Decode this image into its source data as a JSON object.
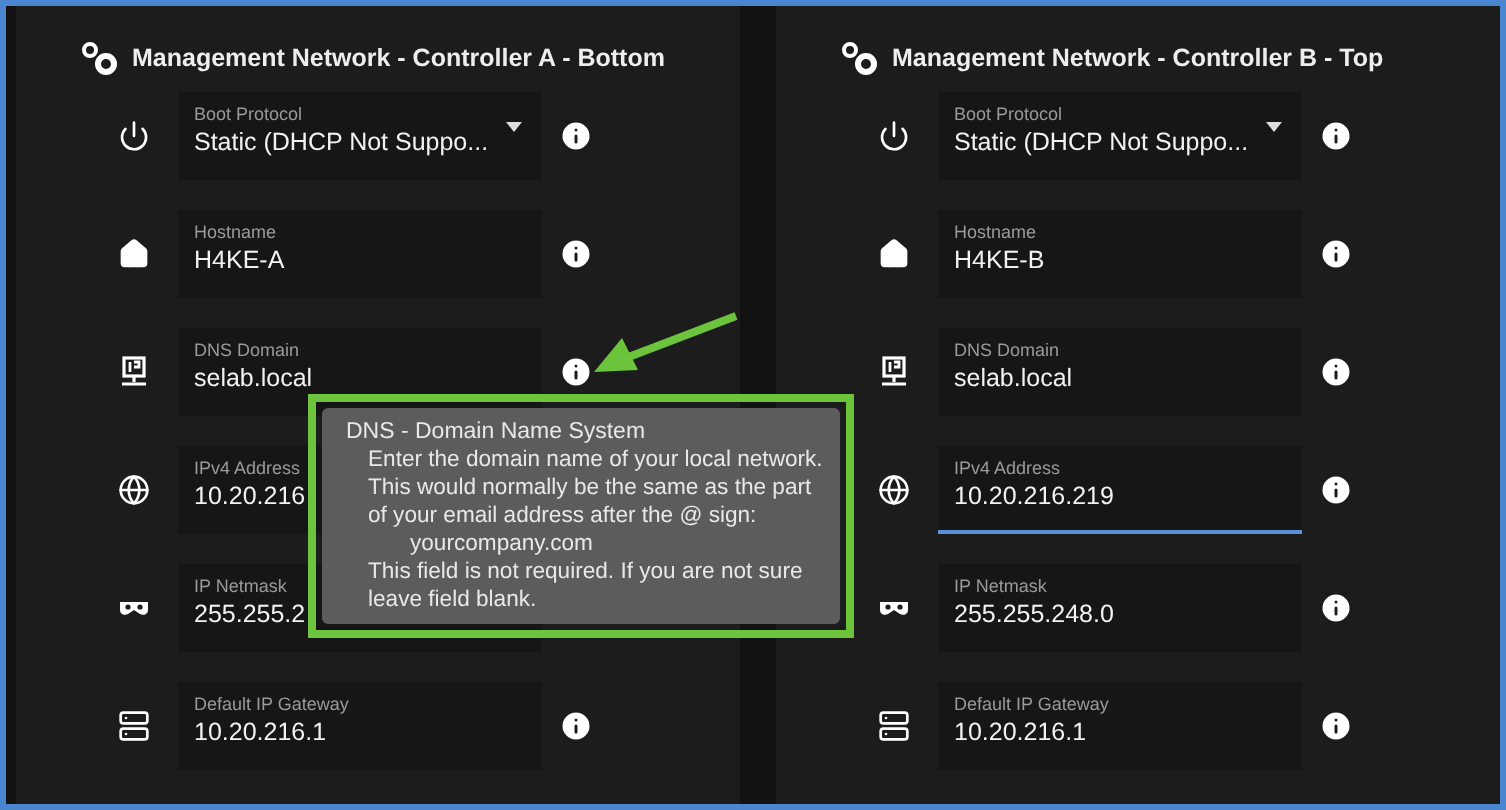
{
  "panels": [
    {
      "title": "Management Network - Controller A - Bottom",
      "fields": [
        {
          "kind": "select",
          "label": "Boot Protocol",
          "value": "Static (DHCP Not Suppo...",
          "focused": false,
          "info": true
        },
        {
          "kind": "text",
          "label": "Hostname",
          "value": "H4KE-A",
          "focused": false,
          "info": true
        },
        {
          "kind": "text",
          "label": "DNS Domain",
          "value": "selab.local",
          "focused": false,
          "info": true
        },
        {
          "kind": "text",
          "label": "IPv4 Address",
          "value": "10.20.216",
          "focused": false,
          "info": false
        },
        {
          "kind": "text",
          "label": "IP Netmask",
          "value": "255.255.2",
          "focused": false,
          "info": false
        },
        {
          "kind": "text",
          "label": "Default IP Gateway",
          "value": "10.20.216.1",
          "focused": false,
          "info": true
        }
      ]
    },
    {
      "title": "Management Network - Controller B - Top",
      "fields": [
        {
          "kind": "select",
          "label": "Boot Protocol",
          "value": "Static (DHCP Not Suppo...",
          "focused": false,
          "info": true
        },
        {
          "kind": "text",
          "label": "Hostname",
          "value": "H4KE-B",
          "focused": false,
          "info": true
        },
        {
          "kind": "text",
          "label": "DNS Domain",
          "value": "selab.local",
          "focused": false,
          "info": true
        },
        {
          "kind": "text",
          "label": "IPv4 Address",
          "value": "10.20.216.219",
          "focused": true,
          "info": true
        },
        {
          "kind": "text",
          "label": "IP Netmask",
          "value": "255.255.248.0",
          "focused": false,
          "info": true
        },
        {
          "kind": "text",
          "label": "Default IP Gateway",
          "value": "10.20.216.1",
          "focused": false,
          "info": true
        }
      ]
    }
  ],
  "tooltip": {
    "title": "DNS - Domain Name System",
    "lines": [
      {
        "kind": "body",
        "text": "Enter the domain name of your local network."
      },
      {
        "kind": "body",
        "text": "This would normally be the same as the part"
      },
      {
        "kind": "body",
        "text": "of your email address after the @ sign:"
      },
      {
        "kind": "example",
        "text": "yourcompany.com"
      },
      {
        "kind": "body",
        "text": "This field is not required. If you are not sure"
      },
      {
        "kind": "body",
        "text": "leave field blank."
      }
    ]
  }
}
